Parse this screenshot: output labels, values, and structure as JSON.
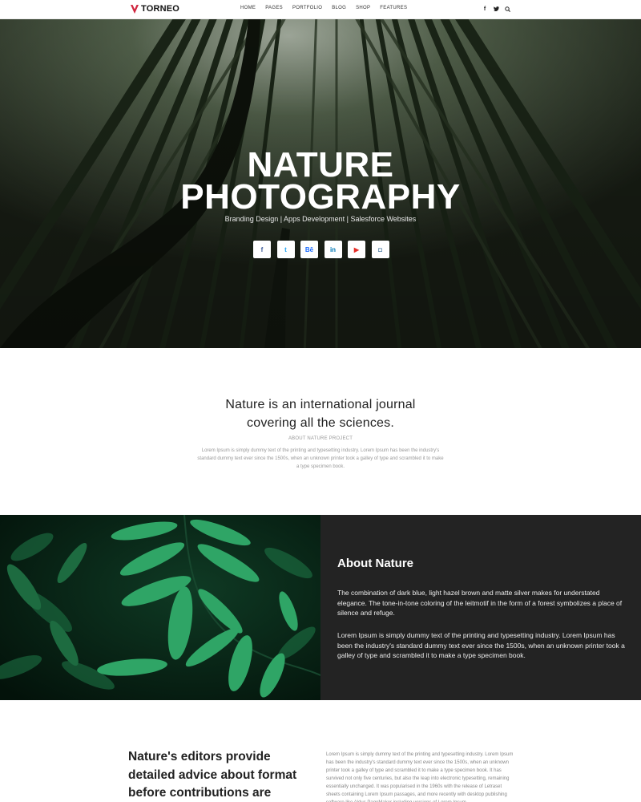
{
  "header": {
    "brand": "TORNEO",
    "nav": [
      "HOME",
      "PAGES",
      "PORTFOLIO",
      "BLOG",
      "SHOP",
      "FEATURES"
    ],
    "icons": [
      "facebook-icon",
      "twitter-icon",
      "search-icon"
    ]
  },
  "hero": {
    "title_line1": "NATURE",
    "title_line2": "PHOTOGRAPHY",
    "subtitle": "Branding Design | Apps Development | Salesforce Websites",
    "socials": [
      {
        "icon": "facebook-icon",
        "glyph": "f",
        "color": "#3b5998"
      },
      {
        "icon": "twitter-icon",
        "glyph": "t",
        "color": "#1da1f2"
      },
      {
        "icon": "behance-icon",
        "glyph": "Bē",
        "color": "#1769ff"
      },
      {
        "icon": "linkedin-icon",
        "glyph": "in",
        "color": "#0077b5"
      },
      {
        "icon": "youtube-icon",
        "glyph": "▶",
        "color": "#e52d27"
      },
      {
        "icon": "instagram-icon",
        "glyph": "◘",
        "color": "#3f729b"
      }
    ]
  },
  "intro": {
    "title_line1": "Nature is an international journal",
    "title_line2": "covering all the sciences.",
    "label": "ABOUT NATURE PROJECT",
    "body": "Lorem Ipsum is simply dummy text of the printing and typesetting industry. Lorem Ipsum has been the industry's standard dummy text ever since the 1500s, when an unknown printer took a galley of type and scrambled it to make a type specimen book."
  },
  "about": {
    "title": "About Nature",
    "p1": "The combination of dark blue, light hazel brown and matte silver makes for understated elegance. The tone-in-tone coloring of the leitmotif in the form of a forest symbolizes a place of silence and refuge.",
    "p2": "Lorem Ipsum is simply dummy text of the printing and typesetting industry. Lorem Ipsum has been the industry's standard dummy text ever since the 1500s, when an unknown printer took a galley of type and scrambled it to make a type specimen book."
  },
  "bottom": {
    "heading": "Nature's editors provide detailed advice about format before contributions are",
    "body": "Lorem Ipsum is simply dummy text of the printing and typesetting industry. Lorem Ipsum has been the industry's standard dummy text ever since the 1500s, when an unknown printer took a galley of type and scrambled it to make a type specimen book. It has survived not only five centuries, but also the leap into electronic typesetting, remaining essentially unchanged. It was popularised in the 1960s with the release of Letraset sheets containing Lorem Ipsum passages, and more recently with desktop publishing software like Aldus PageMaker including versions of Lorem Ipsum."
  },
  "colors": {
    "accent": "#d0263f",
    "dark_panel": "#232323"
  }
}
